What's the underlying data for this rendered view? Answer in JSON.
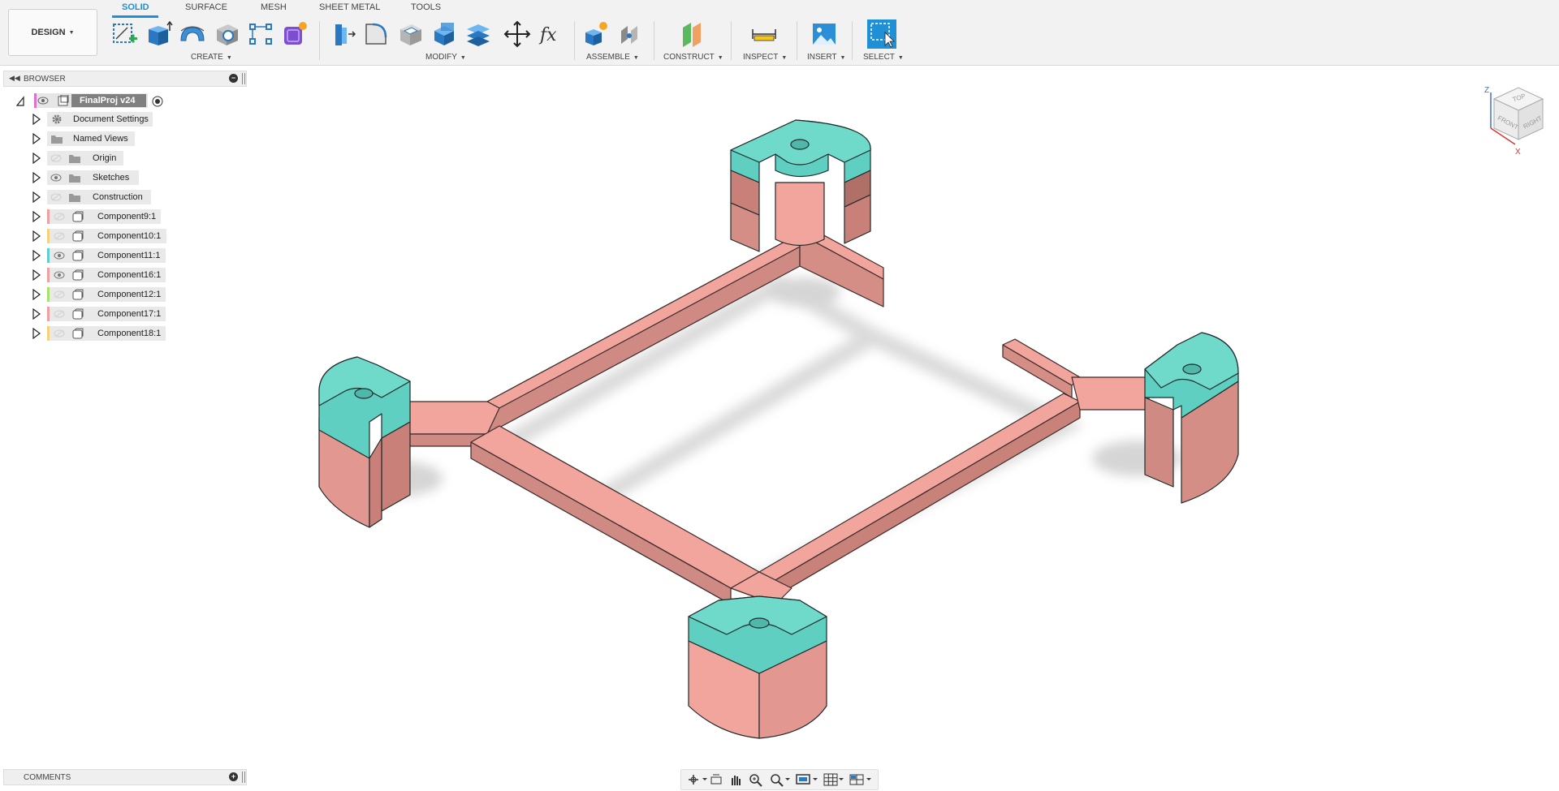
{
  "workspace": {
    "label": "DESIGN"
  },
  "tabs": [
    "SOLID",
    "SURFACE",
    "MESH",
    "SHEET METAL",
    "TOOLS"
  ],
  "groups": {
    "create": "CREATE",
    "modify": "MODIFY",
    "assemble": "ASSEMBLE",
    "construct": "CONSTRUCT",
    "inspect": "INSPECT",
    "insert": "INSERT",
    "select": "SELECT"
  },
  "browser": {
    "title": "BROWSER",
    "root": "FinalProj v24",
    "items": [
      {
        "label": "Document Settings",
        "icon": "gear-icon"
      },
      {
        "label": "Named Views",
        "icon": "folder-icon"
      },
      {
        "label": "Origin",
        "icon": "folder-icon",
        "visibility": "hidden"
      },
      {
        "label": "Sketches",
        "icon": "folder-icon",
        "visibility": "visible"
      },
      {
        "label": "Construction",
        "icon": "folder-icon",
        "visibility": "hidden"
      }
    ],
    "components": [
      {
        "label": "Component9:1",
        "color": "#f0a0a0",
        "visibility": "hidden"
      },
      {
        "label": "Component10:1",
        "color": "#f5d27a",
        "visibility": "hidden"
      },
      {
        "label": "Component11:1",
        "color": "#5ecfd0",
        "visibility": "visible"
      },
      {
        "label": "Component16:1",
        "color": "#f0a0a0",
        "visibility": "visible"
      },
      {
        "label": "Component12:1",
        "color": "#a8e06a",
        "visibility": "hidden"
      },
      {
        "label": "Component17:1",
        "color": "#f0a0a0",
        "visibility": "hidden"
      },
      {
        "label": "Component18:1",
        "color": "#f5d27a",
        "visibility": "hidden"
      }
    ]
  },
  "comments": {
    "title": "COMMENTS"
  },
  "viewcube": {
    "top": "TOP",
    "front": "FRONT",
    "right": "RIGHT",
    "axis_z": "Z",
    "axis_x": "X"
  },
  "colors": {
    "accent": "#1f8fd6",
    "model_body": "#f0a29a",
    "model_top": "#5ecfc0"
  }
}
